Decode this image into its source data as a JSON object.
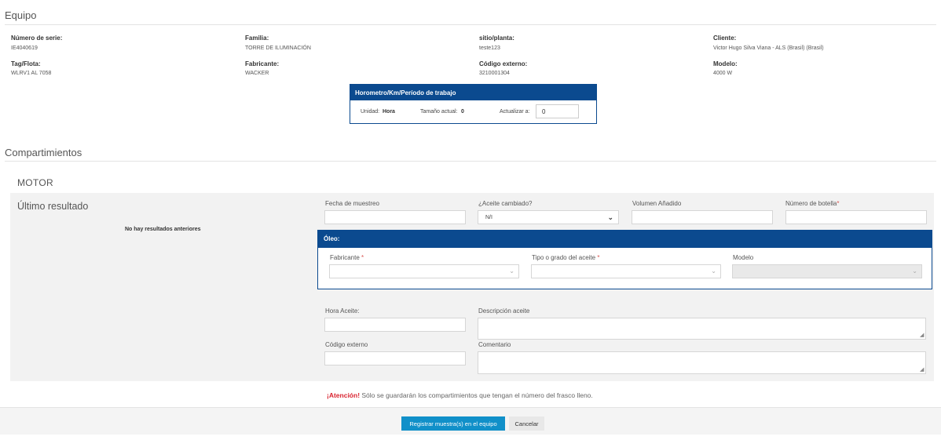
{
  "equipo": {
    "title": "Equipo",
    "fields": {
      "numero_serie_label": "Número de serie:",
      "numero_serie_value": "IE4040619",
      "familia_label": "Familia:",
      "familia_value": "TORRE DE ILUMINACIÓN",
      "sitio_label": "sitio/planta:",
      "sitio_value": "teste123",
      "cliente_label": "Cliente:",
      "cliente_value": "Victor Hugo Silva Viana - ALS (Brasil) (Brasil)",
      "tag_label": "Tag/Flota:",
      "tag_value": "WLRV1 AL 7058",
      "fabricante_label": "Fabricante:",
      "fabricante_value": "WACKER",
      "codigo_externo_label": "Código externo:",
      "codigo_externo_value": "3210001304",
      "modelo_label": "Modelo:",
      "modelo_value": "4000 W"
    }
  },
  "horometro": {
    "title": "Horometro/Km/Período de trabajo",
    "unidad_label": "Unidad:",
    "unidad_value": "Hora",
    "tamano_label": "Tamaño actual:",
    "tamano_value": "0",
    "actualizar_label": "Actualizar a:",
    "actualizar_value": "0"
  },
  "compartimientos": {
    "title": "Compartimientos",
    "motor_title": "MOTOR",
    "ultimo_resultado": "Último resultado",
    "no_results": "No hay resultados anteriores",
    "form": {
      "fecha_label": "Fecha de muestreo",
      "fecha_value": "",
      "aceite_cambiado_label": "¿Aceite cambiado?",
      "aceite_cambiado_value": "N/I",
      "volumen_label": "Volumen Añadido",
      "volumen_value": "",
      "botella_label": "Número de botella",
      "botella_value": "",
      "required_mark": "*",
      "hora_aceite_label": "Hora Aceite:",
      "hora_aceite_value": "",
      "descripcion_label": "Descripción aceite",
      "codigo_externo_label": "Código externo",
      "codigo_externo_value": "",
      "comentario_label": "Comentario"
    },
    "oleo": {
      "title": "Óleo:",
      "fabricante_label": "Fabricante",
      "tipo_label": "Tipo o grado del aceite",
      "modelo_label": "Modelo"
    }
  },
  "attention": {
    "strong": "¡Atención!",
    "text": " Sólo se guardarán los compartimientos que tengan el número del frasco lleno."
  },
  "footer": {
    "register_label": "Registrar muestra(s) en el equipo",
    "cancel_label": "Cancelar"
  },
  "colors": {
    "brand_blue": "#0b4a8f",
    "primary_button": "#1190c9",
    "attention_red": "#d9232f"
  }
}
